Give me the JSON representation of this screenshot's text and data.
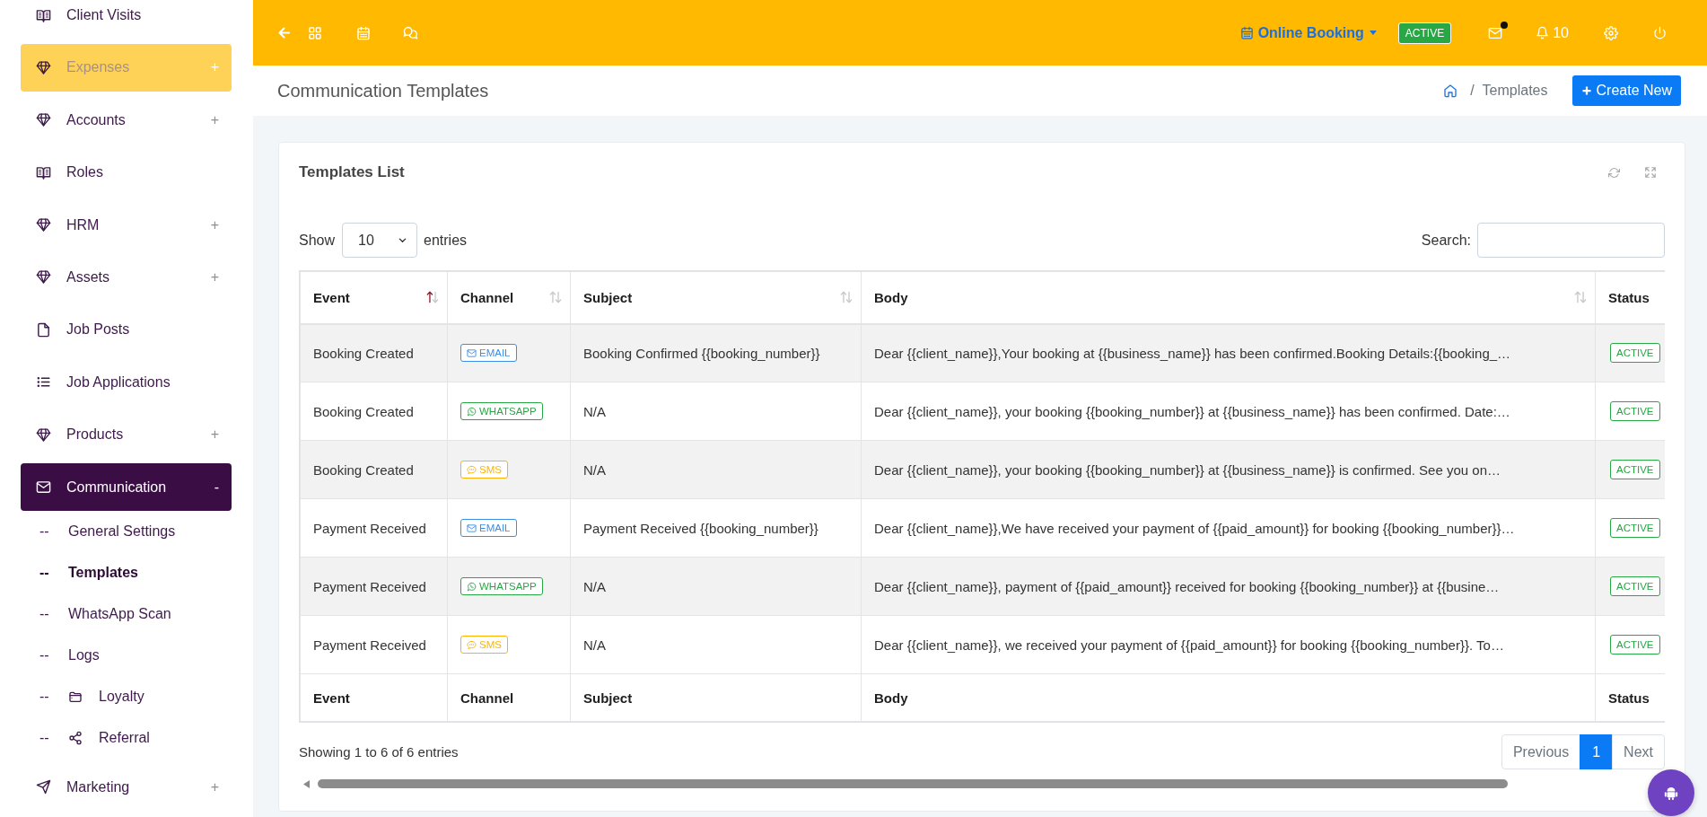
{
  "sidebar": {
    "items": [
      {
        "label": "Client Visits",
        "selected": false,
        "highlighted": false
      },
      {
        "label": "Expenses",
        "toggle": "+",
        "selected": false,
        "highlighted": true
      },
      {
        "label": "Accounts",
        "toggle": "+",
        "selected": false,
        "highlighted": false
      },
      {
        "label": "Roles",
        "selected": false,
        "highlighted": false
      },
      {
        "label": "HRM",
        "toggle": "+",
        "selected": false,
        "highlighted": false
      },
      {
        "label": "Assets",
        "toggle": "+",
        "selected": false,
        "highlighted": false
      },
      {
        "label": "Job Posts",
        "selected": false,
        "highlighted": false
      },
      {
        "label": "Job Applications",
        "selected": false,
        "highlighted": false
      },
      {
        "label": "Products",
        "toggle": "+",
        "selected": false,
        "highlighted": false
      },
      {
        "label": "Communication",
        "toggle": "-",
        "selected": true,
        "highlighted": false,
        "children": [
          {
            "prefix": "--",
            "label": "General Settings",
            "selected": false
          },
          {
            "prefix": "--",
            "label": "Templates",
            "selected": true
          },
          {
            "prefix": "--",
            "label": "WhatsApp Scan",
            "selected": false
          },
          {
            "prefix": "--",
            "label": "Logs",
            "selected": false
          },
          {
            "prefix": "--",
            "label": "Loyalty",
            "selected": false
          },
          {
            "prefix": "--",
            "label": "Referral",
            "selected": false
          }
        ]
      },
      {
        "label": "Marketing",
        "toggle": "+",
        "selected": false,
        "highlighted": false
      }
    ]
  },
  "topbar": {
    "booking_menu": "Online Booking",
    "status_badge": "ACTIVE",
    "mail": {
      "unread": true
    },
    "notifications": "10"
  },
  "page_header": {
    "title": "Communication Templates",
    "breadcrumb": {
      "separator": "/",
      "current": "Templates"
    },
    "create_button": "Create New"
  },
  "card": {
    "title": "Templates List",
    "length_menu": {
      "prefix": "Show",
      "value": "10",
      "suffix": "entries"
    },
    "search": {
      "label": "Search:"
    },
    "table": {
      "columns": [
        {
          "label": "Event",
          "sorted": true
        },
        {
          "label": "Channel",
          "sorted": false
        },
        {
          "label": "Subject",
          "sorted": false
        },
        {
          "label": "Body",
          "sorted": false
        },
        {
          "label": "Status"
        }
      ],
      "rows": [
        {
          "event": "Booking Created",
          "channel": {
            "label": "EMAIL",
            "kind": "email",
            "color": "#3d8ee6"
          },
          "subject": "Booking Confirmed {{booking_number}}",
          "body": "Dear {{client_name}},Your booking at {{business_name}} has been confirmed.Booking Details:{{booking_…",
          "status": "ACTIVE"
        },
        {
          "event": "Booking Created",
          "channel": {
            "label": "WHATSAPP",
            "kind": "whatsapp",
            "color": "#28a745"
          },
          "subject": "N/A",
          "body": "Dear {{client_name}}, your booking {{booking_number}} at {{business_name}} has been confirmed. Date:…",
          "status": "ACTIVE"
        },
        {
          "event": "Booking Created",
          "channel": {
            "label": "SMS",
            "kind": "sms",
            "color": "#ffb300"
          },
          "subject": "N/A",
          "body": "Dear {{client_name}}, your booking {{booking_number}} at {{business_name}} is confirmed. See you on…",
          "status": "ACTIVE"
        },
        {
          "event": "Payment Received",
          "channel": {
            "label": "EMAIL",
            "kind": "email",
            "color": "#3d8ee6"
          },
          "subject": "Payment Received {{booking_number}}",
          "body": "Dear {{client_name}},We have received your payment of {{paid_amount}} for booking {{booking_number}}…",
          "status": "ACTIVE"
        },
        {
          "event": "Payment Received",
          "channel": {
            "label": "WHATSAPP",
            "kind": "whatsapp",
            "color": "#28a745"
          },
          "subject": "N/A",
          "body": "Dear {{client_name}}, payment of {{paid_amount}} received for booking {{booking_number}} at {{busine…",
          "status": "ACTIVE"
        },
        {
          "event": "Payment Received",
          "channel": {
            "label": "SMS",
            "kind": "sms",
            "color": "#ffb300"
          },
          "subject": "N/A",
          "body": "Dear {{client_name}}, we received your payment of {{paid_amount}} for booking {{booking_number}}. To…",
          "status": "ACTIVE"
        }
      ],
      "footer": [
        "Event",
        "Channel",
        "Subject",
        "Body",
        "Status"
      ]
    },
    "info": "Showing 1 to 6 of 6 entries",
    "pagination": [
      {
        "label": "Previous",
        "selected": false
      },
      {
        "label": "1",
        "selected": true
      },
      {
        "label": "Next",
        "selected": false
      }
    ]
  }
}
